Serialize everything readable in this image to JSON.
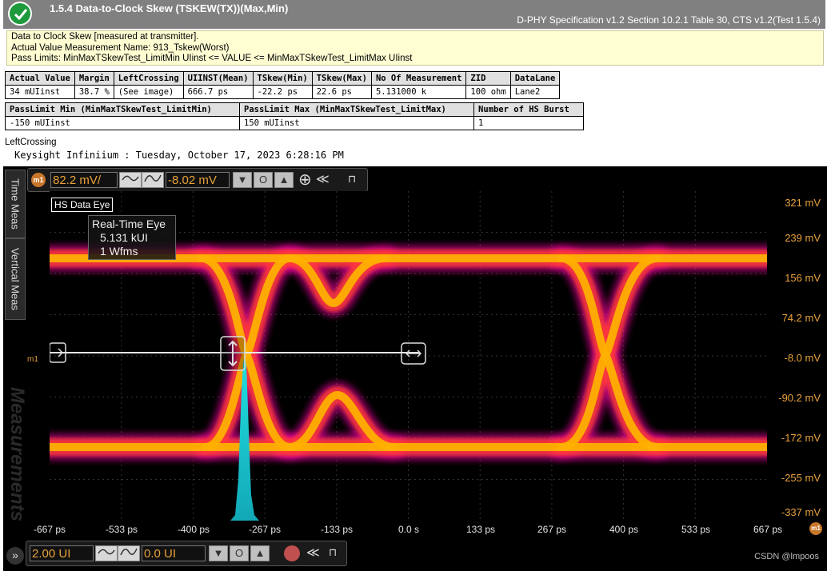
{
  "header": {
    "title": "1.5.4 Data-to-Clock Skew (TSKEW(TX))(Max,Min)",
    "spec": "D-PHY Specification v1.2 Section 10.2.1 Table 30, CTS v1.2(Test 1.5.4)"
  },
  "info": {
    "line1": "Data to Clock Skew [measured at transmitter].",
    "line2": "Actual Value Measurement Name: 913_Tskew(Worst)",
    "line3": "Pass Limits: MinMaxTSkewTest_LimitMin UIinst <= VALUE <= MinMaxTSkewTest_LimitMax UIinst"
  },
  "results": {
    "headers": [
      "Actual Value",
      "Margin",
      "LeftCrossing",
      "UIINST(Mean)",
      "TSkew(Min)",
      "TSkew(Max)",
      "No Of Measurement",
      "ZID",
      "DataLane"
    ],
    "values": [
      "34 mUIinst",
      "38.7 %",
      "(See image)",
      "666.7 ps",
      "-22.2 ps",
      "22.6 ps",
      "5.131000 k",
      "100 ohm",
      "Lane2"
    ]
  },
  "limits": {
    "headers": [
      "PassLimit Min (MinMaxTSkewTest_LimitMin)",
      "PassLimit Max (MinMaxTSkewTest_LimitMax)",
      "Number of HS Burst"
    ],
    "values": [
      "-150 mUIinst",
      "150 mUIinst",
      "1"
    ]
  },
  "image_caption": "LeftCrossing",
  "timestamp": "Keysight Infiniium : Tuesday, October 17, 2023 6:28:16 PM",
  "scope": {
    "side_tabs": [
      "Time Meas",
      "Vertical Meas",
      "Measurements"
    ],
    "marker_badge": "m1",
    "top_toolbar": {
      "scale": "82.2 mV/",
      "offset": "-8.02 mV"
    },
    "bottom_toolbar": {
      "scale": "2.00 UI",
      "offset": "0.0 UI"
    },
    "trace_label": "HS Data Eye",
    "info_box": {
      "line1": "Real-Time Eye",
      "line2": "5.131 kUI",
      "line3": "1 Wfms"
    },
    "marker_label": "m1",
    "y_labels": [
      "321 mV",
      "239 mV",
      "156 mV",
      "74.2 mV",
      "-8.0 mV",
      "-90.2 mV",
      "-172 mV",
      "-255 mV",
      "-337 mV"
    ],
    "x_labels": [
      "-667 ps",
      "-533 ps",
      "-400 ps",
      "-267 ps",
      "-133 ps",
      "0.0 s",
      "133 ps",
      "267 ps",
      "400 ps",
      "533 ps",
      "667 ps"
    ],
    "colors": {
      "accent": "#e8a23a",
      "eye_core": "#ffb000",
      "eye_halo": "#ff00aa",
      "histogram": "#33d6d6"
    }
  },
  "watermark": "CSDN @lmpoos"
}
